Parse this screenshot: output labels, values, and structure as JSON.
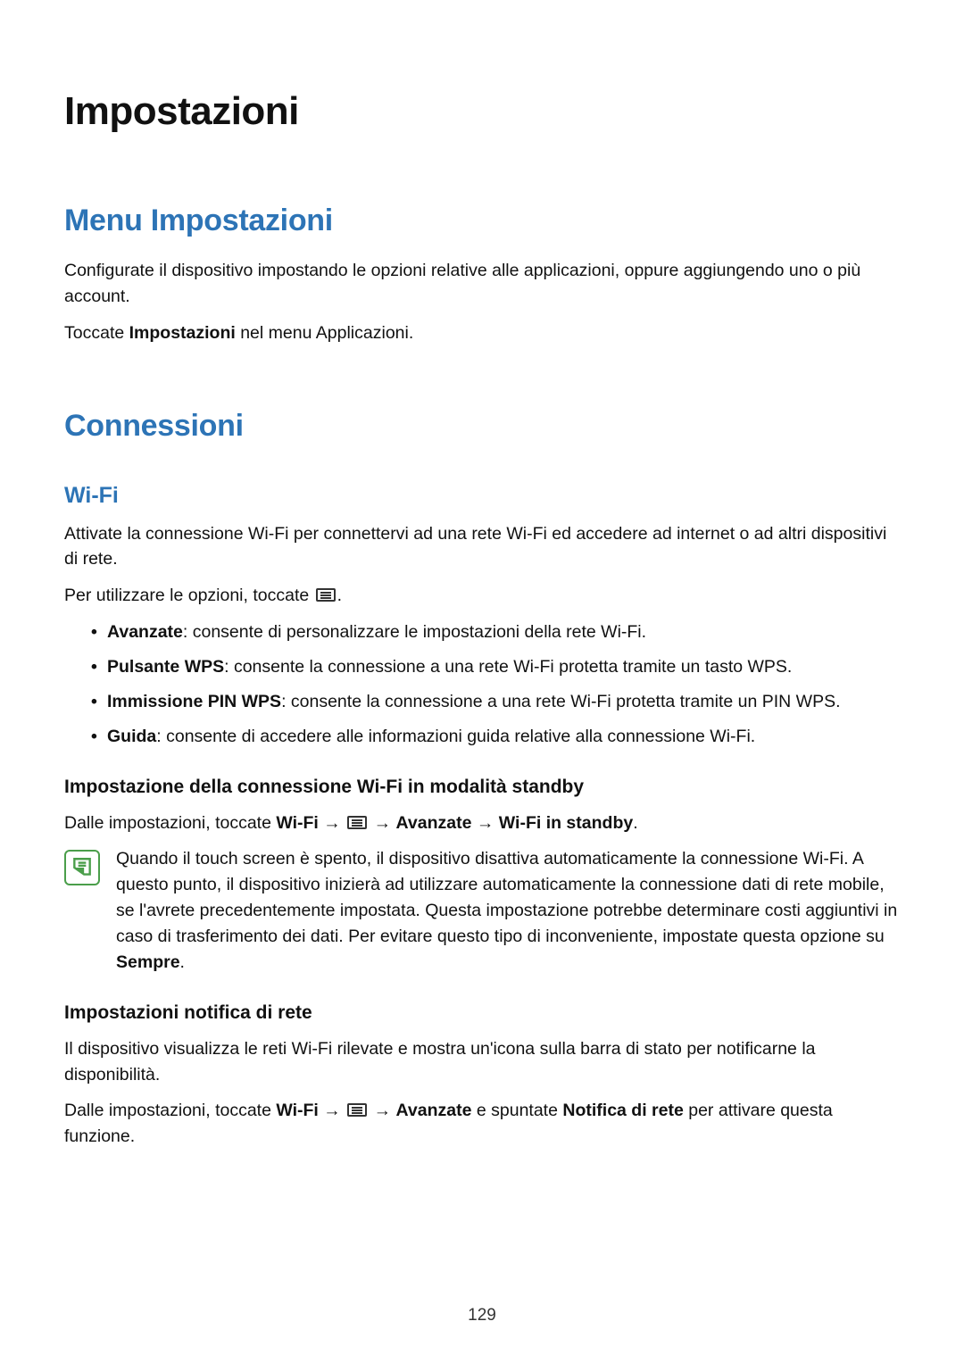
{
  "page_number": "129",
  "h1": "Impostazioni",
  "menu_impostazioni": {
    "title": "Menu Impostazioni",
    "p1": "Configurate il dispositivo impostando le opzioni relative alle applicazioni, oppure aggiungendo uno o più account.",
    "p2_pre": "Toccate ",
    "p2_bold": "Impostazioni",
    "p2_post": " nel menu Applicazioni."
  },
  "connessioni": {
    "title": "Connessioni",
    "wifi": {
      "title": "Wi-Fi",
      "p1": "Attivate la connessione Wi-Fi per connettervi ad una rete Wi-Fi ed accedere ad internet o ad altri dispositivi di rete.",
      "p2_pre": "Per utilizzare le opzioni, toccate ",
      "p2_post": ".",
      "bullets": [
        {
          "bold": "Avanzate",
          "rest": ": consente di personalizzare le impostazioni della rete Wi-Fi."
        },
        {
          "bold": "Pulsante WPS",
          "rest": ": consente la connessione a una rete Wi-Fi protetta tramite un tasto WPS."
        },
        {
          "bold": "Immissione PIN WPS",
          "rest": ": consente la connessione a una rete Wi-Fi protetta tramite un PIN WPS."
        },
        {
          "bold": "Guida",
          "rest": ": consente di accedere alle informazioni guida relative alla connessione Wi-Fi."
        }
      ],
      "standby": {
        "title": "Impostazione della connessione Wi-Fi in modalità standby",
        "path_pre": "Dalle impostazioni, toccate ",
        "path_b1": "Wi-Fi",
        "arrow": " → ",
        "path_b2": "Avanzate",
        "path_b3": "Wi-Fi in standby",
        "path_post": ".",
        "note_pre": "Quando il touch screen è spento, il dispositivo disattiva automaticamente la connessione Wi-Fi. A questo punto, il dispositivo inizierà ad utilizzare automaticamente la connessione dati di rete mobile, se l'avrete precedentemente impostata. Questa impostazione potrebbe determinare costi aggiuntivi in caso di trasferimento dei dati. Per evitare questo tipo di inconveniente, impostate questa opzione su ",
        "note_bold": "Sempre",
        "note_post": "."
      },
      "notifica": {
        "title": "Impostazioni notifica di rete",
        "p1": "Il dispositivo visualizza le reti Wi-Fi rilevate e mostra un'icona sulla barra di stato per notificarne la disponibilità.",
        "p2_pre": "Dalle impostazioni, toccate ",
        "p2_b1": "Wi-Fi",
        "arrow": " → ",
        "p2_b2": "Avanzate",
        "p2_mid": " e spuntate ",
        "p2_b3": "Notifica di rete",
        "p2_post": " per attivare questa funzione."
      }
    }
  }
}
